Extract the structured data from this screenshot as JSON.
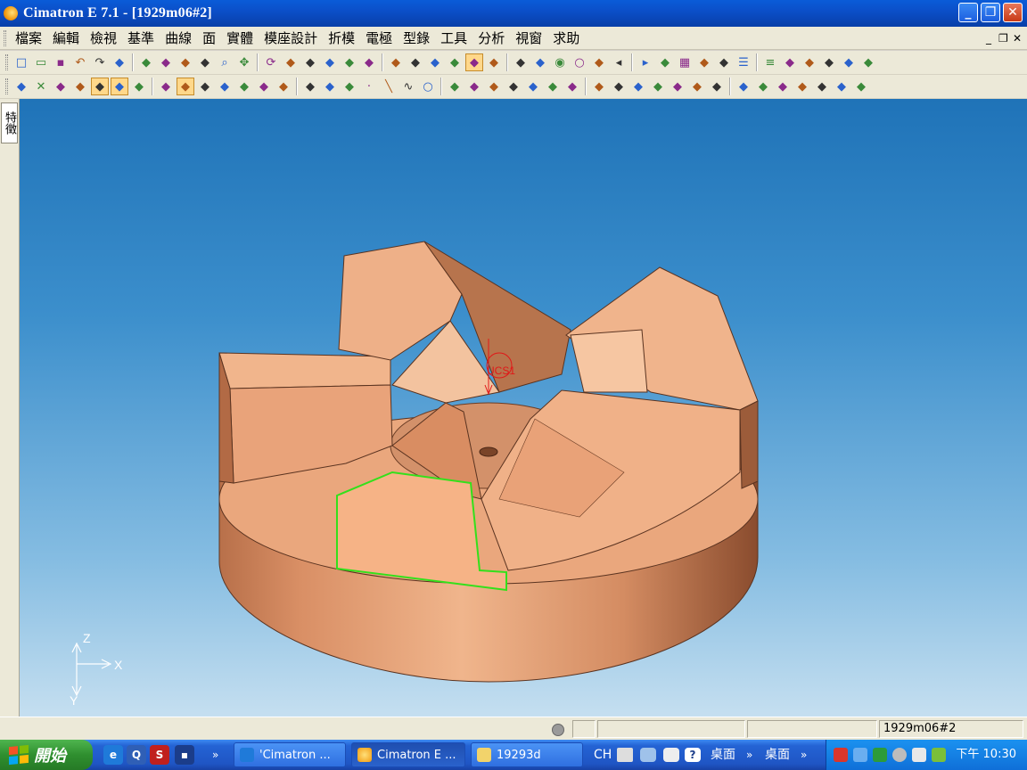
{
  "window": {
    "title": "Cimatron E 7.1 - [1929m06#2]",
    "minimize": "_",
    "restore": "❐",
    "close": "✕"
  },
  "menu": {
    "items": [
      "檔案",
      "編輯",
      "檢視",
      "基準",
      "曲線",
      "面",
      "實體",
      "模座設計",
      "折模",
      "電極",
      "型錄",
      "工具",
      "分析",
      "視窗",
      "求助"
    ],
    "mdi_min": "_",
    "mdi_restore": "❐",
    "mdi_close": "✕"
  },
  "toolbar1": {
    "icons": [
      "new-file-icon",
      "open-folder-icon",
      "save-icon",
      "undo-icon",
      "redo-icon",
      "glasses-icon",
      "refresh-icon",
      "zoom-window-icon",
      "zoom-all-icon",
      "zoom-area-icon",
      "zoom-icon",
      "pan-icon",
      "rotate-icon",
      "iso-view-icon",
      "front-view-icon",
      "top-view-icon",
      "right-view-icon",
      "back-view-icon",
      "bottom-view-icon",
      "left-view-icon",
      "view-manager-icon",
      "view-lock-icon",
      "shaded-icon",
      "wireframe-icon",
      "hidden-icon",
      "render-icon",
      "light-on-icon",
      "light-icon",
      "light-off-icon",
      "prev-icon",
      "next-icon",
      "layer-icon",
      "grid-icon",
      "color-fill-icon",
      "paint-icon",
      "line-style-icon",
      "line-width-icon",
      "pen-icon",
      "pencil-icon",
      "circle-snap-icon",
      "brush-icon",
      "eraser-icon"
    ]
  },
  "toolbar2": {
    "icons": [
      "select-mode-icon",
      "cancel-select-icon",
      "pick-icon",
      "filter-icon",
      "face-filter-icon",
      "edge-filter-icon",
      "solid-filter-icon",
      "x-filter-icon",
      "shell-filter-icon",
      "copy-icon",
      "move-icon",
      "list-icon",
      "transform-icon",
      "mirror-icon",
      "scale-icon",
      "sketch-icon",
      "profile-icon",
      "point-icon",
      "line-icon",
      "spline-icon",
      "circle-icon",
      "offset-curve-icon",
      "fillet-curve-icon",
      "trim-icon",
      "break-icon",
      "join-icon",
      "extrude-icon",
      "revolve-icon",
      "sweep-icon",
      "loft-icon",
      "blend-icon",
      "drive-icon",
      "offset-face-icon",
      "extend-face-icon",
      "split-face-icon",
      "draft-icon",
      "shell-icon",
      "boolean-icon",
      "unite-icon",
      "subtract-icon",
      "chamfer-icon",
      "pattern-icon"
    ]
  },
  "side": {
    "tab": "特徵"
  },
  "viewport": {
    "ucs_label": "UCS1",
    "axis": {
      "z": "Z",
      "x": "X",
      "y": "Y"
    }
  },
  "status": {
    "model": "1929m06#2"
  },
  "taskbar": {
    "start": "開始",
    "tasks": [
      "'Cimatron ...",
      "Cimatron E ...",
      "19293d"
    ],
    "lang": "CH",
    "desktop1": "桌面",
    "desktop2": "桌面",
    "clock": "下午 10:30"
  },
  "colors": {
    "part": "#e8a27a",
    "highlight": "#33e01b",
    "ucs": "#e01818"
  }
}
